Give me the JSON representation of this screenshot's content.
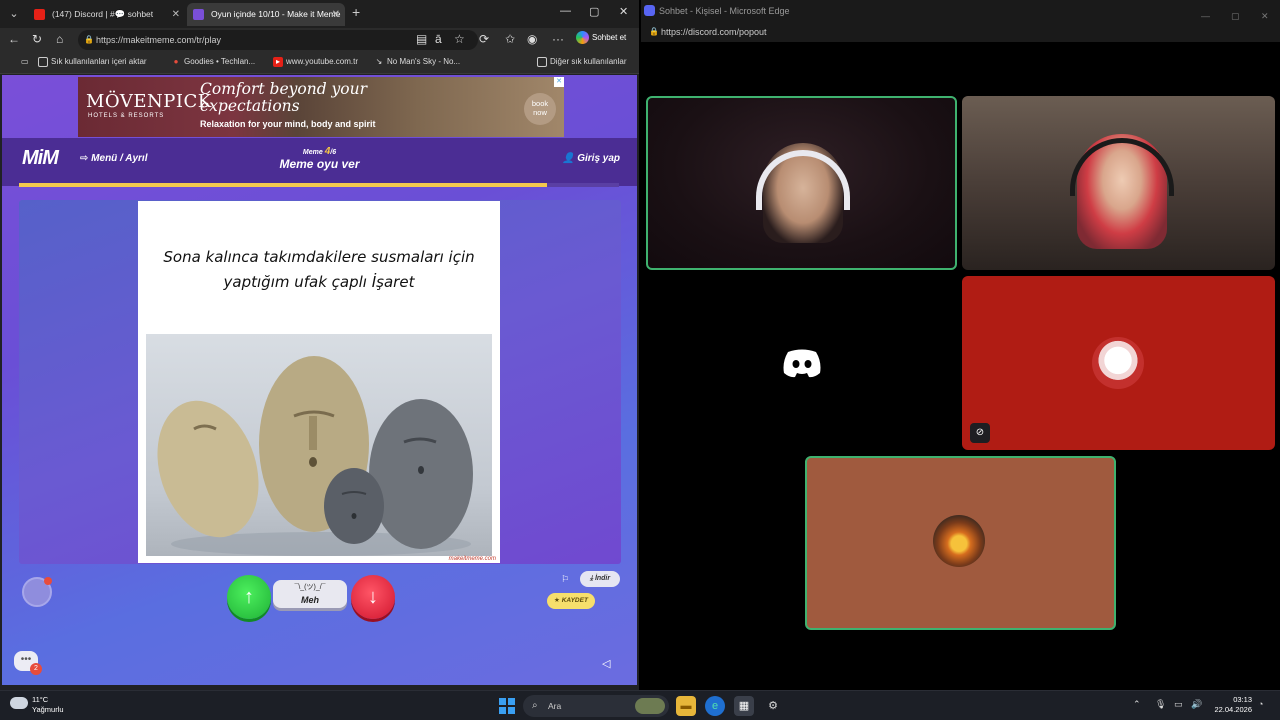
{
  "left_browser": {
    "tabs": [
      {
        "title": "(147) Discord | #​💬 sohbet",
        "active": false
      },
      {
        "title": "Oyun içinde 10/10 - Make it Meme",
        "active": true
      }
    ],
    "new_tab": "+",
    "url": "https://makeitmeme.com/tr/play",
    "copilot_label": "Sohbet et",
    "bookmarks": [
      {
        "label": "Sık kullanılanları içeri aktar"
      },
      {
        "label": "Goodies • Techlan..."
      },
      {
        "label": "www.youtube.com.tr"
      },
      {
        "label": "No Man's Sky - No..."
      },
      {
        "label": "Diğer sık kullanılanlar"
      }
    ]
  },
  "ad": {
    "brand": "MÖVENPICK",
    "brand_sub": "HOTELS & RESORTS",
    "headline": "Comfort beyond your expectations",
    "tagline": "Relaxation for your mind, body and spirit",
    "cta": "book now",
    "close": "✕"
  },
  "game": {
    "logo": "MiM",
    "menu_link": "Menü / Ayrıl",
    "meme_prefix": "Meme",
    "meme_current": "4",
    "meme_total": "/6",
    "vote_title": "Meme oyu ver",
    "login": "Giriş yap",
    "progress": 0.88,
    "meme_caption": "Sona kalınca takımdakilere  susmaları için yaptığım ufak çaplı İşaret",
    "watermark": "makeitmeme.com",
    "meh_face": "¯\\_(ツ)_/¯",
    "meh_label": "Meh",
    "download_label": "İndir",
    "save_label": "KAYDET",
    "chat_badge": "2"
  },
  "discord": {
    "window_title": "Sohbet - Kişisel - Microsoft Edge",
    "url": "https://discord.com/popout"
  },
  "taskbar": {
    "temperature": "11°C",
    "weather": "Yağmurlu",
    "search_placeholder": "Ara",
    "time": "03:13",
    "date": "22.04.2026"
  },
  "colors": {
    "page_purple": "#7a4fd8",
    "header_purple": "#4b2d94",
    "progress_yellow": "#f4c84e",
    "vote_up": "#22c55e",
    "vote_down": "#e11d48",
    "speaking_border": "#3fb26f",
    "muted_tile": "#b01c14"
  }
}
